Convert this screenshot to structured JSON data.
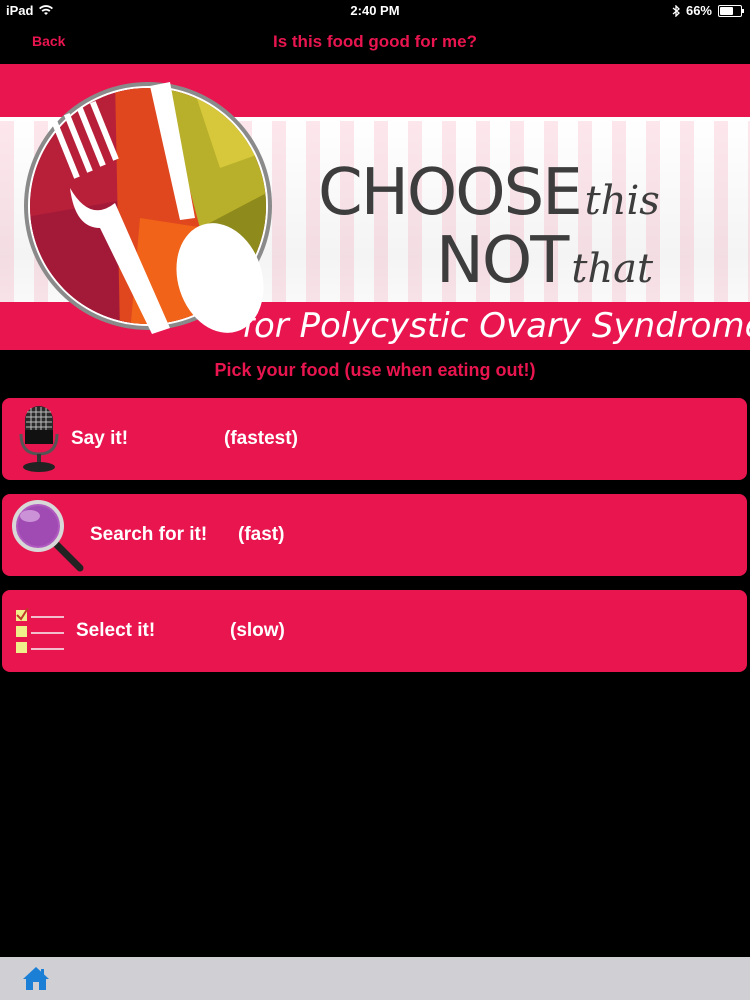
{
  "status": {
    "device": "iPad",
    "time": "2:40 PM",
    "battery": "66%",
    "battery_level": 0.66
  },
  "nav": {
    "back": "Back",
    "title": "Is this food good for me?"
  },
  "banner": {
    "choose": "CHOOSE",
    "this": "this",
    "not": "NOT",
    "that": "that",
    "subtitle": "for Polycystic Ovary Syndrome"
  },
  "instruction": "Pick your food (use when eating out!)",
  "options": [
    {
      "label": "Say it!",
      "speed": "(fastest)",
      "icon": "microphone-icon"
    },
    {
      "label": "Search for it!",
      "speed": "(fast)",
      "icon": "magnifier-icon"
    },
    {
      "label": "Select it!",
      "speed": "(slow)",
      "icon": "checklist-icon"
    }
  ],
  "toolbar": {
    "home_icon": "home-icon"
  },
  "colors": {
    "accent": "#e8154f",
    "background": "#000000",
    "toolbar": "#cfcfd4"
  }
}
